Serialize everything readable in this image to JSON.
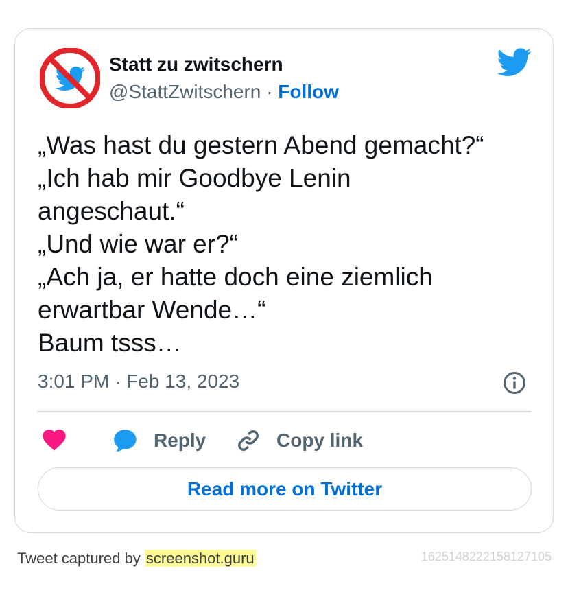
{
  "colors": {
    "accent_blue": "#006fd6",
    "twitter_blue": "#1d9bf0",
    "heart_pink": "#f91880",
    "muted_text": "#536471",
    "border": "#cfd9de",
    "highlight_yellow": "#fdfa96",
    "no_sign_red": "#e0262b"
  },
  "author": {
    "display_name": "Statt zu zwitschern",
    "handle": "@StattZwitschern",
    "separator": "·",
    "follow_label": "Follow",
    "avatar_icon": "no-twitter-bird-avatar"
  },
  "header_icon": "twitter-bird-icon",
  "tweet": {
    "lines": [
      "„Was hast du gestern Abend gemacht?“",
      "„Ich hab mir Goodbye Lenin",
      "angeschaut.“",
      "„Und wie war er?“",
      "„Ach ja, er hatte doch eine ziemlich",
      "erwartbar Wende…“",
      "Baum tsss…"
    ],
    "timestamp": "3:01 PM · Feb 13, 2023",
    "info_icon": "info-icon"
  },
  "actions": {
    "like_icon": "heart-icon",
    "reply_icon": "reply-bubble-icon",
    "reply_label": "Reply",
    "copy_icon": "link-icon",
    "copy_label": "Copy link"
  },
  "read_more_label": "Read more on Twitter",
  "footer": {
    "captured_prefix": "Tweet captured by",
    "brand": "screenshot.guru",
    "tweet_id": "1625148222158127105"
  }
}
